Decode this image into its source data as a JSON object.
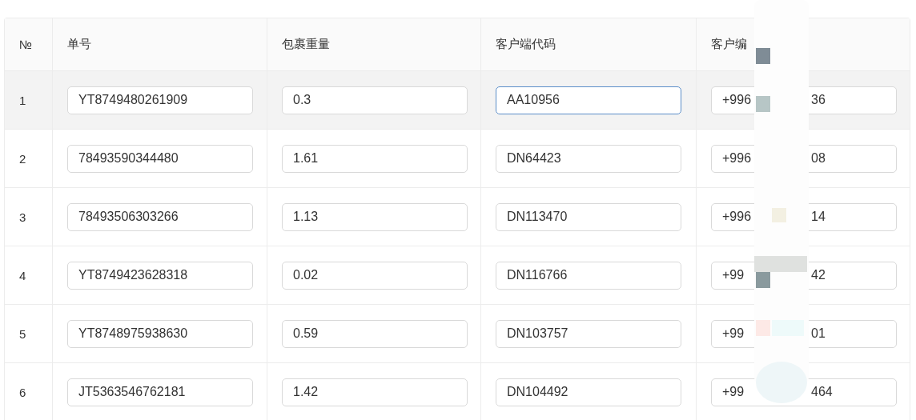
{
  "table": {
    "columns": [
      "№",
      "单号",
      "包裹重量",
      "客户端代码",
      "客户编"
    ],
    "rows": [
      {
        "no": "1",
        "highlighted": true,
        "waybill": {
          "value": "YT8749480261909",
          "focused": false
        },
        "weight": {
          "value": "0.3",
          "focused": false
        },
        "client_code": {
          "value": "AA10956",
          "focused": true
        },
        "phone": {
          "prefix": "+996",
          "suffix": "36"
        }
      },
      {
        "no": "2",
        "highlighted": false,
        "waybill": {
          "value": "78493590344480",
          "focused": false
        },
        "weight": {
          "value": "1.61",
          "focused": false
        },
        "client_code": {
          "value": "DN64423",
          "focused": false
        },
        "phone": {
          "prefix": "+996",
          "suffix": "08"
        }
      },
      {
        "no": "3",
        "highlighted": false,
        "waybill": {
          "value": "78493506303266",
          "focused": false
        },
        "weight": {
          "value": "1.13",
          "focused": false
        },
        "client_code": {
          "value": "DN113470",
          "focused": false
        },
        "phone": {
          "prefix": "+996",
          "suffix": "14"
        }
      },
      {
        "no": "4",
        "highlighted": false,
        "waybill": {
          "value": "YT8749423628318",
          "focused": false
        },
        "weight": {
          "value": "0.02",
          "focused": false
        },
        "client_code": {
          "value": "DN116766",
          "focused": false
        },
        "phone": {
          "prefix": "+99",
          "suffix": "42"
        }
      },
      {
        "no": "5",
        "highlighted": false,
        "waybill": {
          "value": "YT8748975938630",
          "focused": false
        },
        "weight": {
          "value": "0.59",
          "focused": false
        },
        "client_code": {
          "value": "DN103757",
          "focused": false
        },
        "phone": {
          "prefix": "+99",
          "suffix": "01"
        }
      },
      {
        "no": "6",
        "highlighted": false,
        "waybill": {
          "value": "JT5363546762181",
          "focused": false
        },
        "weight": {
          "value": "1.42",
          "focused": false
        },
        "client_code": {
          "value": "DN104492",
          "focused": false
        },
        "phone": {
          "prefix": "+99",
          "suffix": "464"
        }
      }
    ]
  }
}
